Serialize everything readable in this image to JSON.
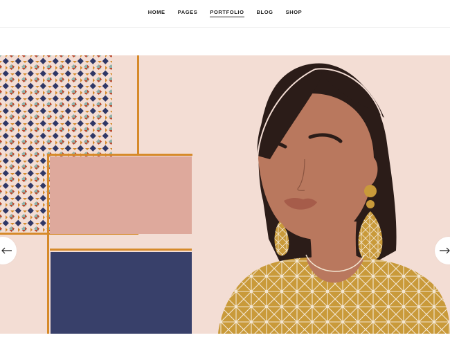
{
  "nav": {
    "items": [
      {
        "label": "HOME",
        "active": false
      },
      {
        "label": "PAGES",
        "active": false
      },
      {
        "label": "PORTFOLIO",
        "active": true
      },
      {
        "label": "BLOG",
        "active": false
      },
      {
        "label": "SHOP",
        "active": false
      }
    ]
  },
  "slider": {
    "prev_icon": "arrow-left-icon",
    "next_icon": "arrow-right-icon"
  },
  "colors": {
    "background": "#f3ddd4",
    "skin": "#b9785e",
    "hair": "#2b1c18",
    "gold": "#c99a3a",
    "pink_block": "#dea99c",
    "navy_block": "#38406a",
    "frame_orange": "#d68a2a",
    "lips": "#a65c4a"
  }
}
